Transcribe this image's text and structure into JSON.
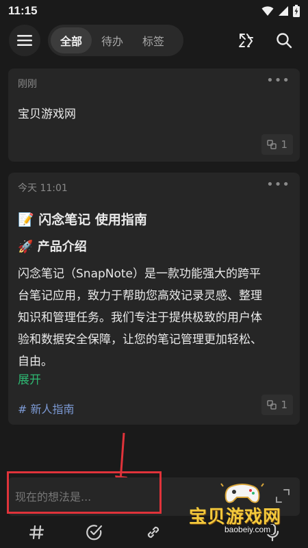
{
  "status": {
    "time": "11:15"
  },
  "tabs": [
    {
      "label": "全部",
      "active": true
    },
    {
      "label": "待办",
      "active": false
    },
    {
      "label": "标签",
      "active": false
    }
  ],
  "notes": [
    {
      "time": "刚刚",
      "content": "宝贝游戏网",
      "refs": "1"
    },
    {
      "time": "今天 11:01",
      "title_emoji": "📝",
      "title": "闪念笔记 使用指南",
      "heading_emoji": "🚀",
      "heading": "产品介绍",
      "body_lines": [
        "闪念笔记（SnapNote）是一款功能强大的跨平",
        "台笔记应用，致力于帮助您高效记录灵感、整理",
        "知识和管理任务。我们专注于提供极致的用户体",
        "验和数据安全保障，让您的笔记管理更加轻松、",
        "自由。"
      ],
      "expand": "展开",
      "tag": "# 新人指南",
      "refs": "1"
    }
  ],
  "composer": {
    "placeholder": "现在的想法是..."
  },
  "watermark": {
    "brand": "宝贝游戏网",
    "url": "baobeiy.com"
  },
  "colors": {
    "accent_green": "#2eb872",
    "highlight_red": "#e0333a",
    "tag_blue": "#7d9bd6"
  }
}
